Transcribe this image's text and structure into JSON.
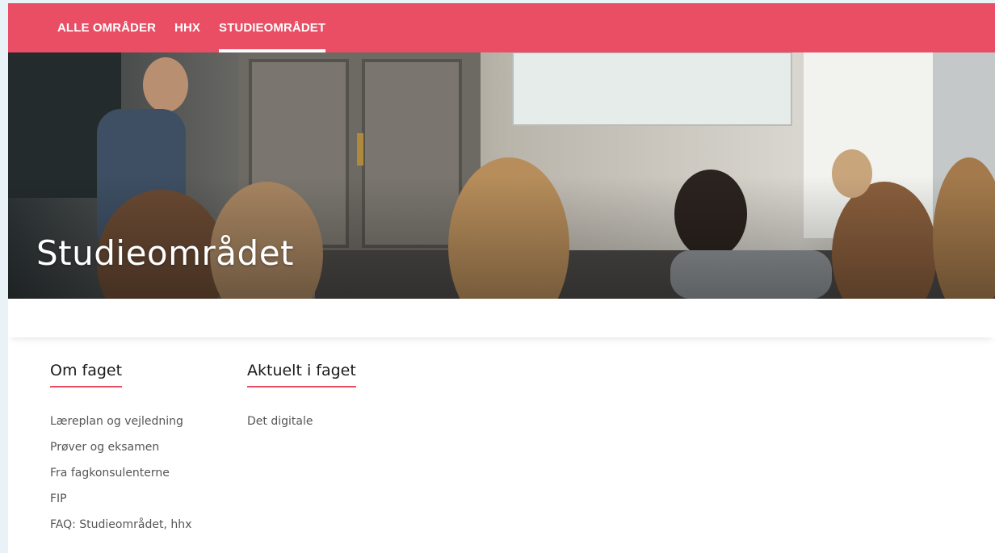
{
  "nav": {
    "items": [
      {
        "label": "ALLE OMRÅDER",
        "active": false
      },
      {
        "label": "HHX",
        "active": false
      },
      {
        "label": "STUDIEOMRÅDET",
        "active": true
      }
    ]
  },
  "hero": {
    "title": "Studieområdet"
  },
  "columns": {
    "om_faget": {
      "heading": "Om faget",
      "links": [
        "Læreplan og vejledning",
        "Prøver og eksamen",
        "Fra fagkonsulenterne",
        "FIP",
        "FAQ: Studieområdet, hhx"
      ]
    },
    "aktuelt": {
      "heading": "Aktuelt i faget",
      "links": [
        "Det digitale"
      ]
    }
  },
  "colors": {
    "accent": "#e94e64",
    "page_bg": "#e9f2f7"
  }
}
